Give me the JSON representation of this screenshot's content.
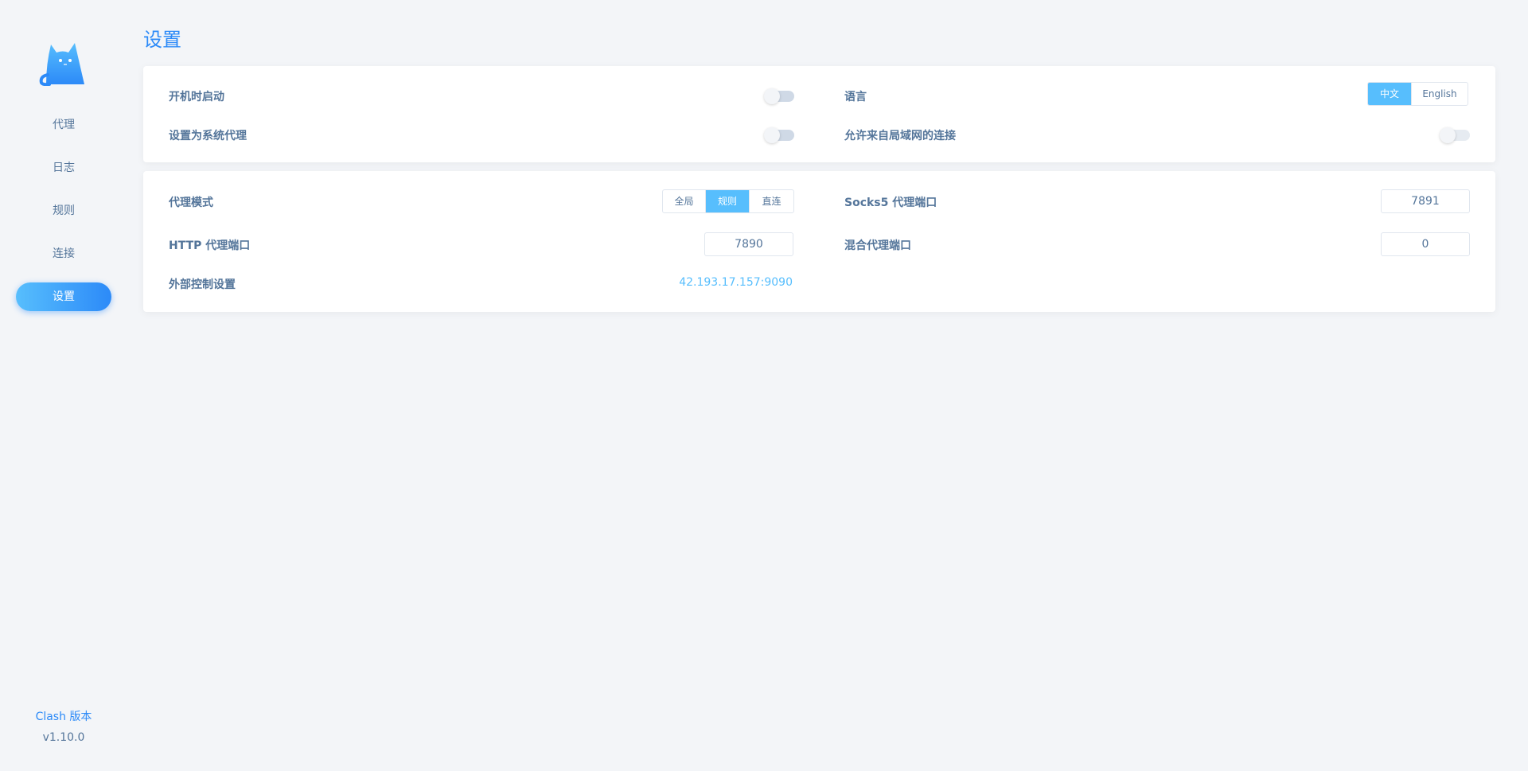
{
  "sidebar": {
    "items": [
      {
        "label": "代理"
      },
      {
        "label": "日志"
      },
      {
        "label": "规则"
      },
      {
        "label": "连接"
      },
      {
        "label": "设置"
      }
    ],
    "active_index": 4,
    "version_title": "Clash 版本",
    "version_value": "v1.10.0"
  },
  "page": {
    "title": "设置"
  },
  "general": {
    "start_on_boot_label": "开机时启动",
    "start_on_boot": false,
    "system_proxy_label": "设置为系统代理",
    "system_proxy": false,
    "language_label": "语言",
    "language_options": [
      "中文",
      "English"
    ],
    "language_selected": "中文",
    "allow_lan_label": "允许来自局域网的连接",
    "allow_lan": false
  },
  "proxy": {
    "mode_label": "代理模式",
    "mode_options": [
      "全局",
      "规则",
      "直连"
    ],
    "mode_selected": "规则",
    "socks5_label": "Socks5 代理端口",
    "socks5_port": "7891",
    "http_label": "HTTP 代理端口",
    "http_port": "7890",
    "mixed_label": "混合代理端口",
    "mixed_port": "0",
    "external_label": "外部控制设置",
    "external_value": "42.193.17.157:9090"
  },
  "colors": {
    "accent": "#2c8af8",
    "accent_light": "#57befd",
    "text": "#54759a",
    "background": "#f3f5f8"
  }
}
